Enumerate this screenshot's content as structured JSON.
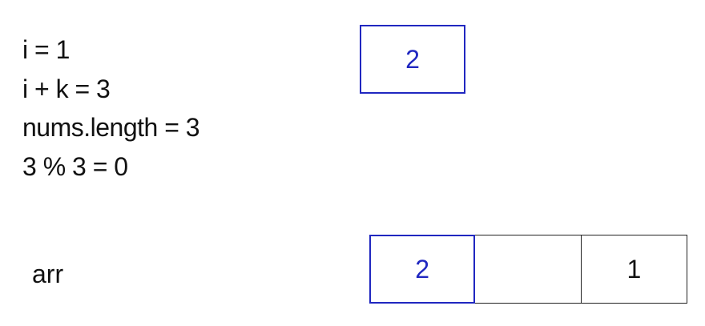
{
  "equations": [
    "i = 1",
    "i + k = 3",
    "nums.length = 3",
    "3 % 3 = 0"
  ],
  "current_value": "2",
  "array": {
    "label": "arr",
    "cells": [
      "2",
      "",
      "1"
    ],
    "highlighted_index": 0
  },
  "colors": {
    "highlight": "#2027c0",
    "text": "#111111",
    "border": "#222222"
  }
}
